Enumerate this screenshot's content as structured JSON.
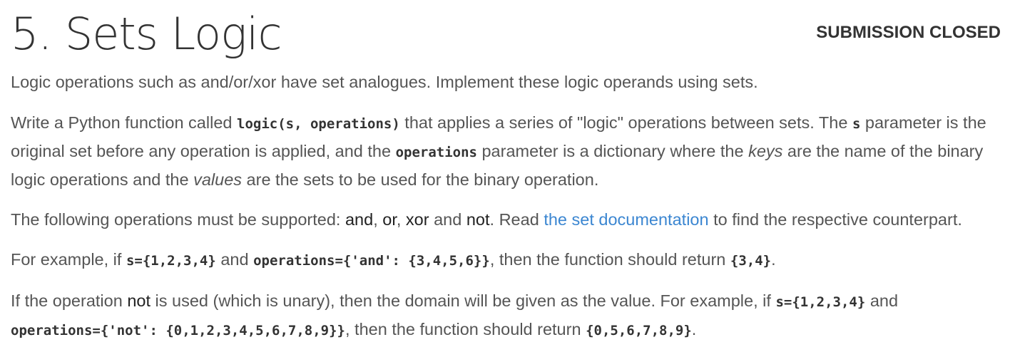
{
  "header": {
    "title": "5. Sets Logic",
    "status": "SUBMISSION CLOSED"
  },
  "content": {
    "p1": "Logic operations such as and/or/xor have set analogues. Implement these logic operands using sets.",
    "p2": {
      "t1": "Write a Python function called ",
      "c1": "logic(s, operations)",
      "t2": " that applies a series of \"logic\" operations between sets. The ",
      "c2": "s",
      "t3": " parameter is the original set before any operation is applied, and the ",
      "c3": "operations",
      "t4": " parameter is a dictionary where the ",
      "e1": "keys",
      "t5": " are the name of the binary logic operations and the ",
      "e2": "values",
      "t6": " are the sets to be used for the binary operation."
    },
    "p3": {
      "t1": "The following operations must be supported: ",
      "b1": "and",
      "t2": ", ",
      "b2": "or",
      "t3": ", ",
      "b3": "xor",
      "t4": " and ",
      "b4": "not",
      "t5": ". Read ",
      "link": "the set documentation",
      "t6": " to find the respective counterpart."
    },
    "p4": {
      "t1": "For example, if ",
      "c1": "s={1,2,3,4}",
      "t2": " and ",
      "c2": "operations={'and': {3,4,5,6}}",
      "t3": ", then the function should return ",
      "c3": "{3,4}",
      "t4": "."
    },
    "p5": {
      "t1": "If the operation ",
      "b1": "not",
      "t2": " is used (which is unary), then the domain will be given as the value. For example, if ",
      "c1": "s={1,2,3,4}",
      "t3": " and ",
      "c2": "operations={'not': {0,1,2,3,4,5,6,7,8,9}}",
      "t4": ", then the function should return ",
      "c3": "{0,5,6,7,8,9}",
      "t5": "."
    }
  },
  "colors": {
    "text": "#555555",
    "title": "#333333",
    "link": "#3b86d1"
  }
}
